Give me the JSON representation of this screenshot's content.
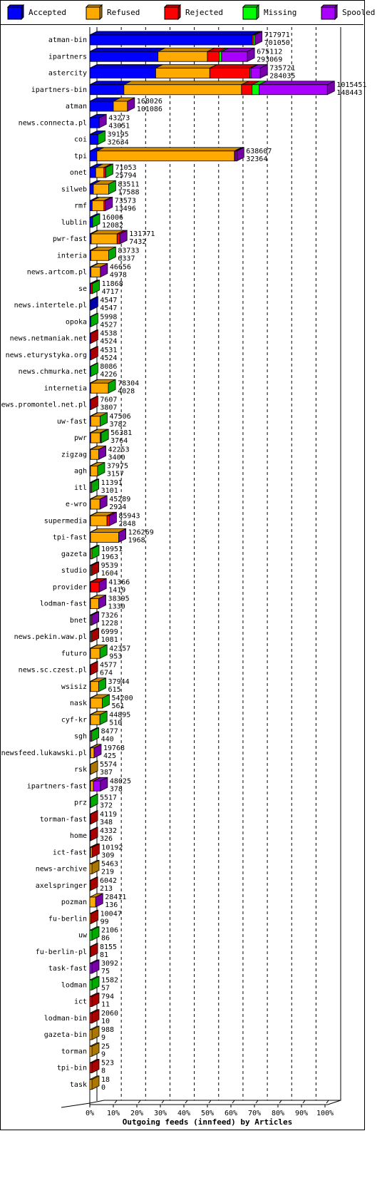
{
  "chart_data": {
    "type": "bar",
    "orientation": "horizontal",
    "stacked": true,
    "style": "3d",
    "title": "Outgoing feeds (innfeed) by Articles",
    "xlabel": "Outgoing feeds (innfeed) by Articles",
    "ylabel": "",
    "xlim": [
      0,
      100
    ],
    "x_unit": "%",
    "x_ticks": [
      "0%",
      "10%",
      "20%",
      "30%",
      "40%",
      "50%",
      "60%",
      "70%",
      "80%",
      "90%",
      "100%"
    ],
    "grid": true,
    "legend_position": "top",
    "legend": [
      {
        "name": "Accepted",
        "color": "#0000ff"
      },
      {
        "name": "Refused",
        "color": "#ffaa00"
      },
      {
        "name": "Rejected",
        "color": "#ff0000"
      },
      {
        "name": "Missing",
        "color": "#00ff00"
      },
      {
        "name": "Spooled",
        "color": "#aa00ff"
      }
    ],
    "series_names": [
      "Accepted",
      "Refused",
      "Rejected",
      "Missing",
      "Spooled"
    ],
    "rows": [
      {
        "name": "atman-bin",
        "total": "717971",
        "accepted_count": "701050",
        "segments": [
          69.0,
          0,
          0.5,
          0.7,
          0
        ]
      },
      {
        "name": "ipartners",
        "total": "675112",
        "accepted_count": "293069",
        "segments": [
          29.0,
          21.0,
          5.0,
          1.0,
          11.0
        ]
      },
      {
        "name": "astercity",
        "total": "735721",
        "accepted_count": "284035",
        "segments": [
          28.0,
          23.0,
          17.0,
          0.5,
          4.0
        ]
      },
      {
        "name": "ipartners-bin",
        "total": "1015451",
        "accepted_count": "148443",
        "segments": [
          14.5,
          50.0,
          4.5,
          3.0,
          29.0
        ]
      },
      {
        "name": "atman",
        "total": "168026",
        "accepted_count": "101086",
        "segments": [
          10.0,
          6.0,
          0,
          0,
          0
        ]
      },
      {
        "name": "news.connecta.pl",
        "total": "43273",
        "accepted_count": "43051",
        "segments": [
          4.0,
          0,
          0,
          0,
          0
        ]
      },
      {
        "name": "coi",
        "total": "39195",
        "accepted_count": "32634",
        "segments": [
          3.5,
          0,
          0,
          0,
          0
        ]
      },
      {
        "name": "tpi",
        "total": "638607",
        "accepted_count": "32364",
        "segments": [
          3.0,
          58.5,
          0.3,
          0,
          0.7
        ]
      },
      {
        "name": "onet",
        "total": "71053",
        "accepted_count": "25794",
        "segments": [
          2.5,
          3.5,
          0.8,
          0,
          0
        ]
      },
      {
        "name": "silweb",
        "total": "83511",
        "accepted_count": "17588",
        "segments": [
          1.5,
          6.5,
          0,
          0,
          0
        ]
      },
      {
        "name": "rmf",
        "total": "73573",
        "accepted_count": "13496",
        "segments": [
          1.0,
          5.0,
          0.6,
          0,
          0
        ]
      },
      {
        "name": "lublin",
        "total": "16006",
        "accepted_count": "12082",
        "segments": [
          1.2,
          0,
          0,
          0,
          0
        ]
      },
      {
        "name": "pwr-fast",
        "total": "131771",
        "accepted_count": "7432",
        "segments": [
          0.6,
          11.0,
          1.2,
          0,
          0
        ]
      },
      {
        "name": "interia",
        "total": "83733",
        "accepted_count": "6337",
        "segments": [
          0.5,
          7.5,
          0,
          0,
          0
        ]
      },
      {
        "name": "news.artcom.pl",
        "total": "46656",
        "accepted_count": "4978",
        "segments": [
          0.5,
          4.0,
          0,
          0,
          0
        ]
      },
      {
        "name": "se",
        "total": "11868",
        "accepted_count": "4717",
        "segments": [
          0.4,
          0,
          0.7,
          0,
          0
        ]
      },
      {
        "name": "news.intertele.pl",
        "total": "4547",
        "accepted_count": "4547",
        "segments": [
          0.4,
          0,
          0,
          0,
          0
        ]
      },
      {
        "name": "opoka",
        "total": "5998",
        "accepted_count": "4527",
        "segments": [
          0.4,
          0,
          0,
          0,
          0
        ]
      },
      {
        "name": "news.netmaniak.net",
        "total": "4538",
        "accepted_count": "4524",
        "segments": [
          0.4,
          0,
          0,
          0,
          0
        ]
      },
      {
        "name": "news.eturystyka.org",
        "total": "4531",
        "accepted_count": "4524",
        "segments": [
          0.4,
          0,
          0,
          0,
          0
        ]
      },
      {
        "name": "news.chmurka.net",
        "total": "8086",
        "accepted_count": "4226",
        "segments": [
          0.4,
          0,
          0,
          0,
          0
        ]
      },
      {
        "name": "internetia",
        "total": "78304",
        "accepted_count": "4028",
        "segments": [
          0.4,
          7.5,
          0,
          0,
          0
        ]
      },
      {
        "name": "news.promontel.net.pl",
        "total": "7607",
        "accepted_count": "3807",
        "segments": [
          0.4,
          0,
          0,
          0,
          0
        ]
      },
      {
        "name": "uw-fast",
        "total": "47506",
        "accepted_count": "3782",
        "segments": [
          0.4,
          4.0,
          0,
          0,
          0
        ]
      },
      {
        "name": "pwr",
        "total": "56381",
        "accepted_count": "3764",
        "segments": [
          0.4,
          4.0,
          0.5,
          0,
          0
        ]
      },
      {
        "name": "zigzag",
        "total": "42253",
        "accepted_count": "3400",
        "segments": [
          0.3,
          3.5,
          0,
          0,
          0
        ]
      },
      {
        "name": "agh",
        "total": "37975",
        "accepted_count": "3157",
        "segments": [
          0.3,
          3.0,
          0,
          0,
          0
        ]
      },
      {
        "name": "itl",
        "total": "11391",
        "accepted_count": "3101",
        "segments": [
          0.3,
          0.5,
          0,
          0,
          0
        ]
      },
      {
        "name": "e-wro",
        "total": "45289",
        "accepted_count": "2924",
        "segments": [
          0.3,
          4.0,
          0,
          0,
          0
        ]
      },
      {
        "name": "supermedia",
        "total": "85943",
        "accepted_count": "2848",
        "segments": [
          0.3,
          7.0,
          1.0,
          0,
          0
        ]
      },
      {
        "name": "tpi-fast",
        "total": "126269",
        "accepted_count": "1968",
        "segments": [
          0.2,
          12.0,
          0,
          0,
          0
        ]
      },
      {
        "name": "gazeta",
        "total": "10951",
        "accepted_count": "1963",
        "segments": [
          0.2,
          0.6,
          0,
          0,
          0
        ]
      },
      {
        "name": "studio",
        "total": "9539",
        "accepted_count": "1604",
        "segments": [
          0.2,
          0.5,
          0,
          0,
          0
        ]
      },
      {
        "name": "provider",
        "total": "41366",
        "accepted_count": "1419",
        "segments": [
          0.1,
          0,
          3.7,
          0,
          0
        ]
      },
      {
        "name": "lodman-fast",
        "total": "38395",
        "accepted_count": "1330",
        "segments": [
          0.1,
          3.5,
          0,
          0,
          0
        ]
      },
      {
        "name": "bnet",
        "total": "7326",
        "accepted_count": "1228",
        "segments": [
          0.1,
          0.5,
          0,
          0,
          0
        ]
      },
      {
        "name": "news.pekin.waw.pl",
        "total": "6999",
        "accepted_count": "1081",
        "segments": [
          0.1,
          0.5,
          0,
          0,
          0
        ]
      },
      {
        "name": "futuro",
        "total": "42357",
        "accepted_count": "953",
        "segments": [
          0.1,
          4.0,
          0,
          0,
          0
        ]
      },
      {
        "name": "news.sc.czest.pl",
        "total": "4577",
        "accepted_count": "674",
        "segments": [
          0.1,
          0,
          0,
          0,
          0
        ]
      },
      {
        "name": "wsisiz",
        "total": "37944",
        "accepted_count": "615",
        "segments": [
          0.1,
          3.5,
          0,
          0,
          0
        ]
      },
      {
        "name": "nask",
        "total": "54200",
        "accepted_count": "561",
        "segments": [
          0.1,
          5.0,
          0,
          0,
          0
        ]
      },
      {
        "name": "cyf-kr",
        "total": "44895",
        "accepted_count": "510",
        "segments": [
          0.05,
          4.0,
          0,
          0,
          0
        ]
      },
      {
        "name": "sgh",
        "total": "8477",
        "accepted_count": "440",
        "segments": [
          0.05,
          0.5,
          0,
          0,
          0
        ]
      },
      {
        "name": "newsfeed.lukawski.pl",
        "total": "19768",
        "accepted_count": "425",
        "segments": [
          0.05,
          1.5,
          0,
          0,
          0
        ]
      },
      {
        "name": "rsk",
        "total": "5574",
        "accepted_count": "387",
        "segments": [
          0.05,
          0,
          0,
          0,
          0
        ]
      },
      {
        "name": "ipartners-fast",
        "total": "48025",
        "accepted_count": "378",
        "segments": [
          0.05,
          1.2,
          0,
          0,
          3.0
        ]
      },
      {
        "name": "prz",
        "total": "5517",
        "accepted_count": "372",
        "segments": [
          0.05,
          0,
          0,
          0,
          0
        ]
      },
      {
        "name": "torman-fast",
        "total": "4119",
        "accepted_count": "348",
        "segments": [
          0.05,
          0,
          0,
          0,
          0
        ]
      },
      {
        "name": "home",
        "total": "4332",
        "accepted_count": "326",
        "segments": [
          0.05,
          0,
          0,
          0,
          0
        ]
      },
      {
        "name": "ict-fast",
        "total": "10192",
        "accepted_count": "309",
        "segments": [
          0.05,
          0.7,
          0,
          0,
          0
        ]
      },
      {
        "name": "news-archive",
        "total": "5463",
        "accepted_count": "219",
        "segments": [
          0,
          0,
          0,
          0,
          0
        ]
      },
      {
        "name": "axelspringer",
        "total": "6042",
        "accepted_count": "213",
        "segments": [
          0,
          0.2,
          0,
          0,
          0
        ]
      },
      {
        "name": "pozman",
        "total": "28411",
        "accepted_count": "136",
        "segments": [
          0,
          2.5,
          0,
          0,
          0
        ]
      },
      {
        "name": "fu-berlin",
        "total": "10047",
        "accepted_count": "99",
        "segments": [
          0,
          0.5,
          0,
          0,
          0
        ]
      },
      {
        "name": "uw",
        "total": "2106",
        "accepted_count": "86",
        "segments": [
          0,
          0,
          0,
          0,
          0
        ]
      },
      {
        "name": "fu-berlin-pl",
        "total": "8155",
        "accepted_count": "81",
        "segments": [
          0,
          0.2,
          0,
          0,
          0
        ]
      },
      {
        "name": "task-fast",
        "total": "3092",
        "accepted_count": "75",
        "segments": [
          0,
          0,
          0,
          0,
          0
        ]
      },
      {
        "name": "lodman",
        "total": "1582",
        "accepted_count": "57",
        "segments": [
          0,
          0,
          0,
          0,
          0
        ]
      },
      {
        "name": "ict",
        "total": "794",
        "accepted_count": "11",
        "segments": [
          0,
          0,
          0,
          0,
          0
        ]
      },
      {
        "name": "lodman-bin",
        "total": "2060",
        "accepted_count": "10",
        "segments": [
          0,
          0,
          0,
          0,
          0
        ]
      },
      {
        "name": "gazeta-bin",
        "total": "988",
        "accepted_count": "9",
        "segments": [
          0,
          0,
          0,
          0,
          0
        ]
      },
      {
        "name": "torman",
        "total": "25",
        "accepted_count": "9",
        "segments": [
          0,
          0,
          0,
          0,
          0
        ]
      },
      {
        "name": "tpi-bin",
        "total": "523",
        "accepted_count": "8",
        "segments": [
          0,
          0,
          0,
          0,
          0
        ]
      },
      {
        "name": "task",
        "total": "18",
        "accepted_count": "0",
        "segments": [
          0,
          0,
          0,
          0,
          0
        ]
      }
    ],
    "tail_colors": {
      "atman-bin": "Spooled",
      "ipartners": "Spooled",
      "astercity": "Spooled",
      "ipartners-bin": "Spooled",
      "atman": "Spooled",
      "news.connecta.pl": "Spooled",
      "coi": "Missing",
      "tpi": "Spooled",
      "onet": "Missing",
      "silweb": "Missing",
      "rmf": "Spooled",
      "lublin": "Missing",
      "pwr-fast": "Spooled",
      "interia": "Missing",
      "news.artcom.pl": "Spooled",
      "se": "Missing",
      "news.intertele.pl": "Accepted",
      "opoka": "Missing",
      "news.netmaniak.net": "Rejected",
      "news.eturystyka.org": "Rejected",
      "news.chmurka.net": "Missing",
      "internetia": "Missing",
      "news.promontel.net.pl": "Rejected",
      "uw-fast": "Missing",
      "pwr": "Missing",
      "zigzag": "Spooled",
      "agh": "Missing",
      "itl": "Missing",
      "e-wro": "Spooled",
      "supermedia": "Spooled",
      "tpi-fast": "Spooled",
      "gazeta": "Missing",
      "studio": "Rejected",
      "provider": "Spooled",
      "lodman-fast": "Spooled",
      "bnet": "Spooled",
      "news.pekin.waw.pl": "Rejected",
      "futuro": "Missing",
      "news.sc.czest.pl": "Rejected",
      "wsisiz": "Missing",
      "nask": "Missing",
      "cyf-kr": "Missing",
      "sgh": "Missing",
      "newsfeed.lukawski.pl": "Spooled",
      "rsk": "Refused",
      "ipartners-fast": "Spooled",
      "prz": "Missing",
      "torman-fast": "Rejected",
      "home": "Rejected",
      "ict-fast": "Rejected",
      "news-archive": "Refused",
      "axelspringer": "Rejected",
      "pozman": "Spooled",
      "fu-berlin": "Rejected",
      "uw": "Missing",
      "fu-berlin-pl": "Rejected",
      "task-fast": "Spooled",
      "lodman": "Missing",
      "ict": "Rejected",
      "lodman-bin": "Rejected",
      "gazeta-bin": "Refused",
      "torman": "Refused",
      "tpi-bin": "Rejected",
      "task": "Refused"
    }
  }
}
